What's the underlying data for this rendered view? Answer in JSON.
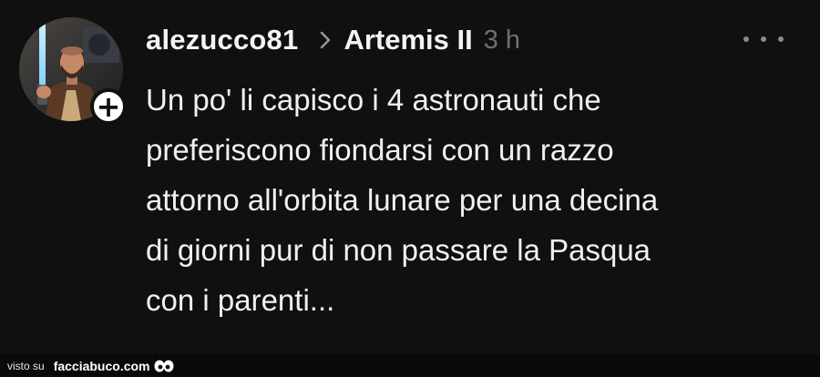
{
  "post": {
    "username": "alezucco81",
    "community": "Artemis II",
    "time": "3 h",
    "text": "Un po' li capisco i 4 astronauti che\npreferiscono fiondarsi con un razzo\nattorno all'orbita lunare per una decina\ndi giorni pur di non passare la Pasqua\ncon i parenti...",
    "follow_symbol": "+"
  },
  "icons": {
    "avatar": "user-avatar-photo",
    "follow": "plus-icon",
    "separator": "chevron-right-icon",
    "menu": "more-horizontal-icon",
    "watermark": "eyes-icon"
  },
  "footer": {
    "visto_label": "visto su",
    "site": "facciabuco.com"
  },
  "colors": {
    "background": "#101010",
    "text": "#f0f0f0",
    "muted": "#6f6f6f"
  }
}
